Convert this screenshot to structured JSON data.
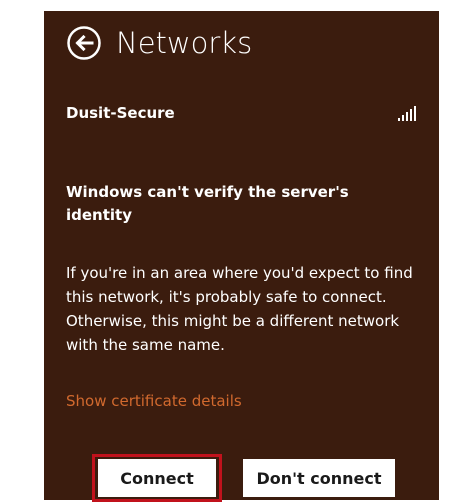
{
  "header": {
    "title": "Networks",
    "back_icon": "back-arrow-circle-icon"
  },
  "network": {
    "name": "Dusit-Secure",
    "signal_icon": "wifi-signal-icon",
    "signal_bars": 5
  },
  "warning": {
    "title": "Windows can't verify the server's identity",
    "body": "If you're in an area where you'd expect to find this network, it's probably safe to connect. Otherwise, this might be a different network with the same name."
  },
  "link": {
    "cert_details": "Show certificate details"
  },
  "buttons": {
    "connect": "Connect",
    "dont_connect": "Don't connect"
  },
  "colors": {
    "panel_bg": "#3b1c0e",
    "link": "#d1692e",
    "focus_border": "#c1121c"
  }
}
